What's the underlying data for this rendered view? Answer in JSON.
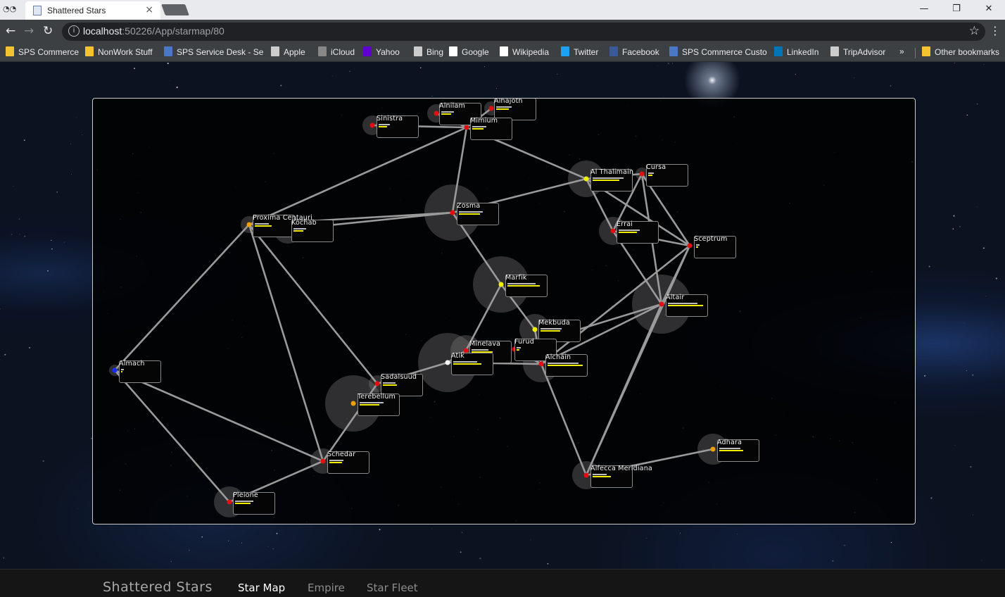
{
  "browser": {
    "tab_title": "Shattered Stars",
    "tab_close": "×",
    "url_host": "localhost",
    "url_path": ":50226/App/starmap/80",
    "window_min": "—",
    "window_restore": "❐",
    "window_close": "✕",
    "bookmarks": [
      {
        "label": "SPS Commerce",
        "icon": "folder-icon",
        "color": "#f4c430"
      },
      {
        "label": "NonWork Stuff",
        "icon": "folder-icon",
        "color": "#f4c430"
      },
      {
        "label": "SPS Service Desk - Se",
        "icon": "sps-icon",
        "color": "#4a78c4"
      },
      {
        "label": "Apple",
        "icon": "page-icon",
        "color": "#cccccc"
      },
      {
        "label": "iCloud",
        "icon": "apple-icon",
        "color": "#888888"
      },
      {
        "label": "Yahoo",
        "icon": "yahoo-icon",
        "color": "#5f01d1"
      },
      {
        "label": "Bing",
        "icon": "page-icon",
        "color": "#cccccc"
      },
      {
        "label": "Google",
        "icon": "google-icon",
        "color": "#ffffff"
      },
      {
        "label": "Wikipedia",
        "icon": "wikipedia-icon",
        "color": "#ffffff"
      },
      {
        "label": "Twitter",
        "icon": "twitter-icon",
        "color": "#1da1f2"
      },
      {
        "label": "Facebook",
        "icon": "facebook-icon",
        "color": "#3b5998"
      },
      {
        "label": "SPS Commerce Custo",
        "icon": "sps-icon",
        "color": "#4a78c4"
      },
      {
        "label": "LinkedIn",
        "icon": "linkedin-icon",
        "color": "#0077b5"
      },
      {
        "label": "TripAdvisor",
        "icon": "page-icon",
        "color": "#cccccc"
      }
    ],
    "more_bookmarks": "»",
    "other_bookmarks": "Other bookmarks"
  },
  "app": {
    "brand": "Shattered Stars",
    "nav": [
      {
        "label": "Star Map",
        "active": true
      },
      {
        "label": "Empire",
        "active": false
      },
      {
        "label": "Star Fleet",
        "active": false
      }
    ]
  },
  "starmap": {
    "systems": [
      {
        "id": "sinistra",
        "name": "Sinistra",
        "star": "#e01010",
        "halo": 14,
        "bars": [
          16,
          12
        ]
      },
      {
        "id": "alnilam",
        "name": "Alnilam",
        "star": "#e01010",
        "halo": 13,
        "bars": [
          18,
          14
        ]
      },
      {
        "id": "alhajoth",
        "name": "Alhajoth",
        "star": "#e01010",
        "halo": 10,
        "bars": [
          22,
          18
        ]
      },
      {
        "id": "mimium",
        "name": "Mimium",
        "star": "#e01010",
        "halo": 0,
        "bars": [
          20,
          16
        ]
      },
      {
        "id": "al-thalimain",
        "name": "Al Thalimain",
        "star": "#f0f000",
        "halo": 26,
        "bars": [
          44,
          38
        ]
      },
      {
        "id": "cursa",
        "name": "Cursa",
        "star": "#e01010",
        "halo": 9,
        "bars": [
          8,
          6
        ]
      },
      {
        "id": "zosma",
        "name": "Zosma",
        "star": "#e01010",
        "halo": 40,
        "bars": [
          34,
          30
        ]
      },
      {
        "id": "proxima-centauri",
        "name": "Proxima Centauri",
        "star": "#f0a000",
        "halo": 12,
        "bars": [
          20,
          24
        ]
      },
      {
        "id": "kochab",
        "name": "Kochab",
        "star": "#e01010",
        "halo": 20,
        "bars": [
          18,
          14
        ]
      },
      {
        "id": "errai",
        "name": "Errai",
        "star": "#e01010",
        "halo": 20,
        "bars": [
          30,
          26
        ]
      },
      {
        "id": "sceptrum",
        "name": "Sceptrum",
        "star": "#e01010",
        "halo": 0,
        "bars": [
          5,
          3
        ]
      },
      {
        "id": "marfik",
        "name": "Marfik",
        "star": "#f0f000",
        "halo": 40,
        "bars": [
          40,
          46
        ]
      },
      {
        "id": "altair",
        "name": "Altair",
        "star": "#e01010",
        "halo": 42,
        "bars": [
          42,
          50
        ]
      },
      {
        "id": "mekbuda",
        "name": "Mekbuda",
        "star": "#f0f000",
        "halo": 22,
        "bars": [
          30,
          28
        ]
      },
      {
        "id": "minelava",
        "name": "Minelava",
        "star": "#e01010",
        "halo": 22,
        "bars": [
          24,
          30
        ]
      },
      {
        "id": "furud",
        "name": "Furud",
        "star": "#e01010",
        "halo": 0,
        "bars": [
          6,
          4
        ]
      },
      {
        "id": "atik",
        "name": "Atik",
        "star": "#ffffff",
        "halo": 42,
        "bars": [
          34,
          40
        ]
      },
      {
        "id": "alchain",
        "name": "Alchain",
        "star": "#e01010",
        "halo": 26,
        "bars": [
          44,
          50
        ]
      },
      {
        "id": "almach",
        "name": "Almach",
        "star": "#1a2cff",
        "halo": 8,
        "bars": [
          4,
          2
        ]
      },
      {
        "id": "sadalsuud",
        "name": "Sadalsuud",
        "star": "#e01010",
        "halo": 12,
        "bars": [
          18,
          20
        ]
      },
      {
        "id": "terebellum",
        "name": "Terebellum",
        "star": "#f0a000",
        "halo": 40,
        "bars": [
          34,
          28
        ]
      },
      {
        "id": "schedar",
        "name": "Schedar",
        "star": "#e01010",
        "halo": 18,
        "bars": [
          20,
          18
        ]
      },
      {
        "id": "adhara",
        "name": "Adhara",
        "star": "#f0a000",
        "halo": 22,
        "bars": [
          30,
          34
        ]
      },
      {
        "id": "alfecca-meridiana",
        "name": "Alfecca Meridiana",
        "star": "#e01010",
        "halo": 20,
        "bars": [
          20,
          26
        ]
      },
      {
        "id": "pleione",
        "name": "Pleione",
        "star": "#e01010",
        "halo": 22,
        "bars": [
          26,
          22
        ]
      }
    ]
  }
}
